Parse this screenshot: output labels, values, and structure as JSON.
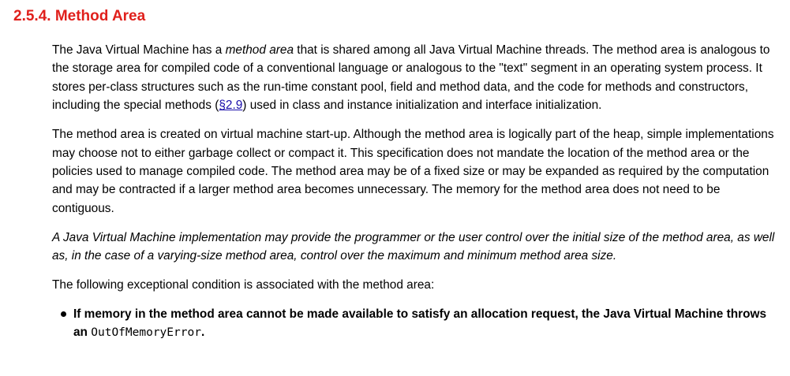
{
  "section": {
    "number": "2.5.4.",
    "title": "Method Area"
  },
  "p1": {
    "t1": "The Java Virtual Machine has a ",
    "em1": "method area",
    "t2": " that is shared among all Java Virtual Machine threads. The method area is analogous to the storage area for compiled code of a conventional language or analogous to the \"text\" segment in an operating system process. It stores per-class structures such as the run-time constant pool, field and method data, and the code for methods and constructors, including the special methods (",
    "link_text": "§2.9",
    "t3": ") used in class and instance initialization and interface initialization."
  },
  "p2": "The method area is created on virtual machine start-up. Although the method area is logically part of the heap, simple implementations may choose not to either garbage collect or compact it. This specification does not mandate the location of the method area or the policies used to manage compiled code. The method area may be of a fixed size or may be expanded as required by the computation and may be contracted if a larger method area becomes unnecessary. The memory for the method area does not need to be contiguous.",
  "p3": "A Java Virtual Machine implementation may provide the programmer or the user control over the initial size of the method area, as well as, in the case of a varying-size method area, control over the maximum and minimum method area size.",
  "p4": "The following exceptional condition is associated with the method area:",
  "bullet1": {
    "text": "If memory in the method area cannot be made available to satisfy an allocation request, the Java Virtual Machine throws an ",
    "code": "OutOfMemoryError",
    "end": "."
  },
  "colors": {
    "title": "#e0201c",
    "link": "#1a0dab",
    "text": "#000000"
  }
}
